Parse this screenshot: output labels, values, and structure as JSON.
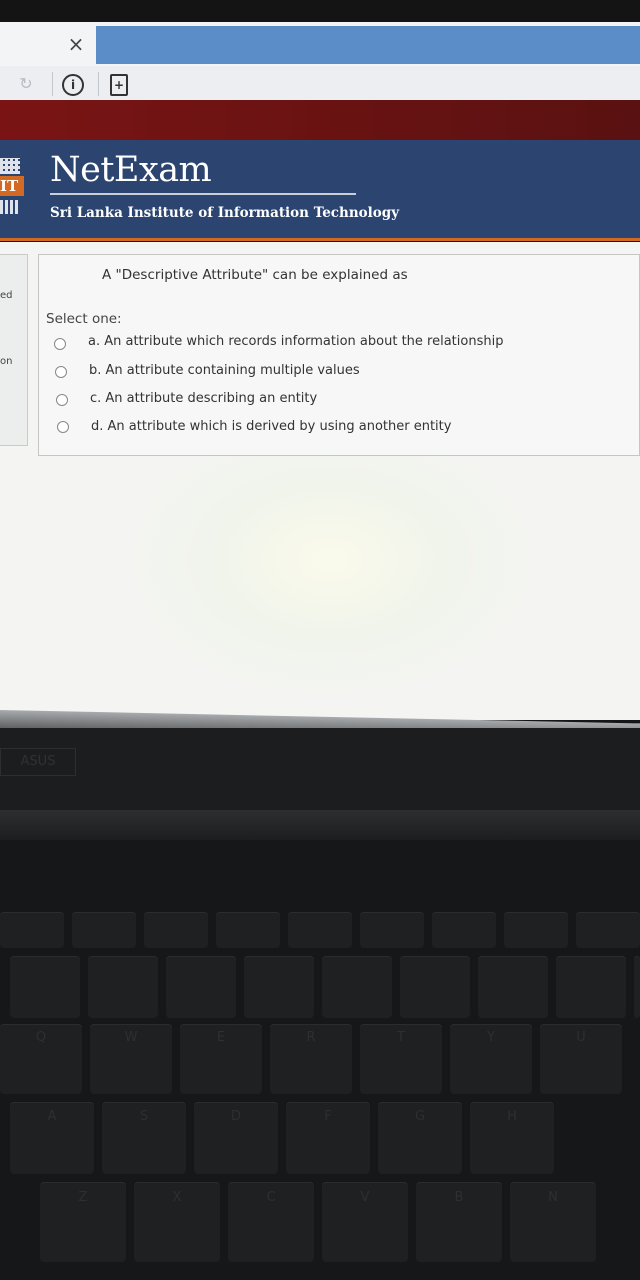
{
  "browser": {
    "close_tab_glyph": "×",
    "reload_glyph": "↻",
    "info_glyph": "i",
    "page_glyph": "+"
  },
  "header": {
    "title": "NetExam",
    "institute": "Sri Lanka Institute of Information Technology",
    "logo_letters": "IT",
    "colors": {
      "band": "#2b4470",
      "maroon": "#6e1313",
      "accent": "#d36a23"
    }
  },
  "left_panel": {
    "text_1": "ed",
    "text_2": "on"
  },
  "question": {
    "text": "A \"Descriptive Attribute\" can be explained as",
    "prompt": "Select one:",
    "options": [
      {
        "label": "a. An attribute which records information about the relationship",
        "selected": false
      },
      {
        "label": "b. An attribute containing multiple values",
        "selected": false
      },
      {
        "label": "c. An attribute describing an entity",
        "selected": false
      },
      {
        "label": "d. An attribute which is derived by using another entity",
        "selected": false
      }
    ]
  },
  "laptop": {
    "bezel_label": "ASUS",
    "keys": [
      "Q",
      "W",
      "E",
      "R",
      "T",
      "Y",
      "U",
      "A",
      "S",
      "D",
      "F",
      "G",
      "H",
      "Z",
      "X",
      "C",
      "V",
      "B",
      "N"
    ]
  }
}
